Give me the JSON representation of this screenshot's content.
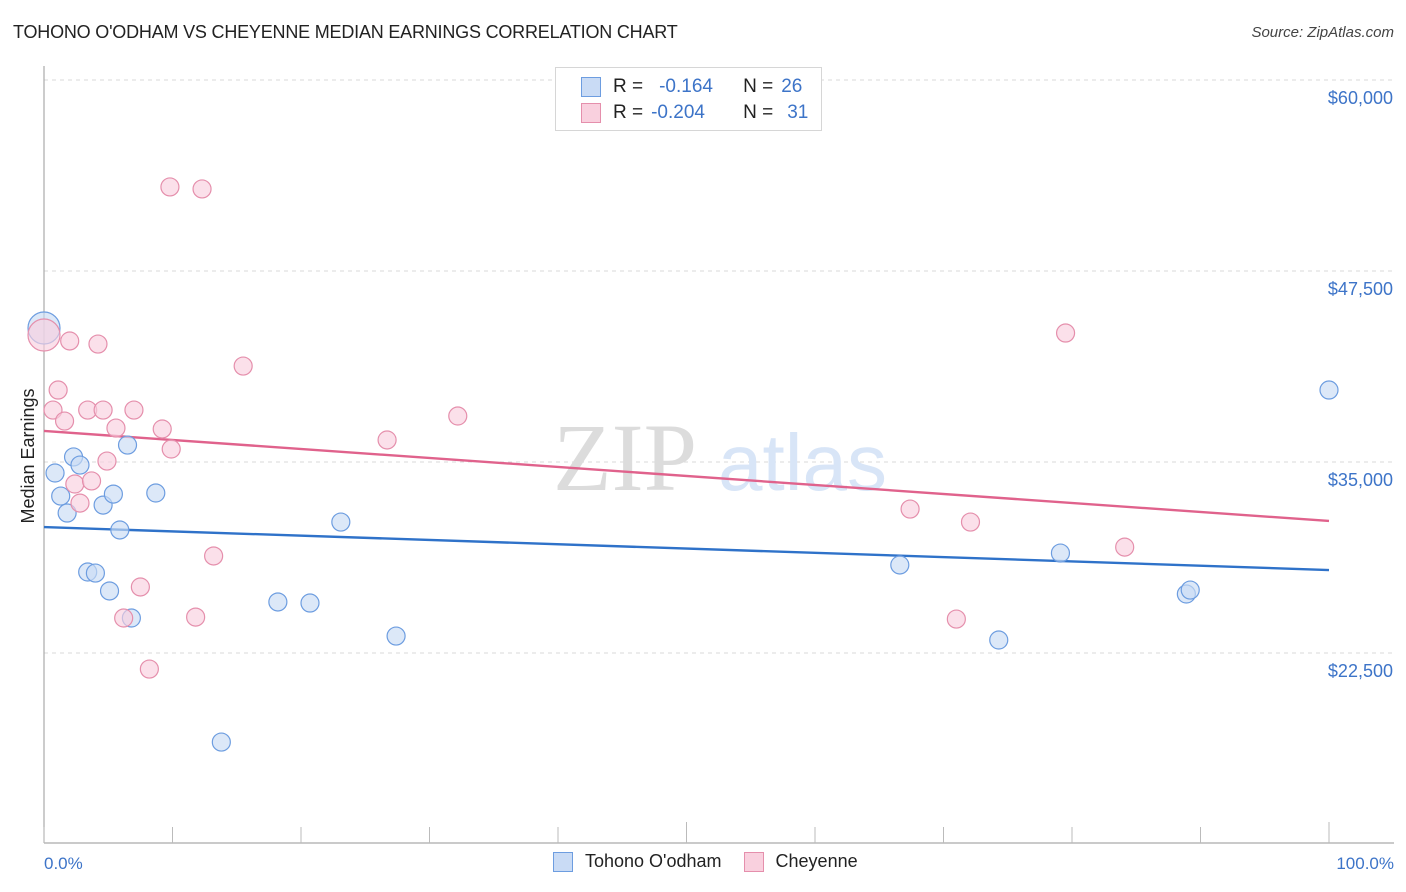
{
  "chart_data": {
    "type": "scatter",
    "title": "TOHONO O'ODHAM VS CHEYENNE MEDIAN EARNINGS CORRELATION CHART",
    "source": "Source: ZipAtlas.com",
    "watermark": {
      "zip": "ZIP",
      "atlas": "atlas"
    },
    "xlabel": "",
    "ylabel": "Median Earnings",
    "xlim": [
      0,
      100
    ],
    "ylim": [
      10000,
      62000
    ],
    "x_tick_labels": {
      "left": "0.0%",
      "right": "100.0%"
    },
    "y_ticks": [
      {
        "value": 60000,
        "label": "$60,000"
      },
      {
        "value": 47500,
        "label": "$47,500"
      },
      {
        "value": 35000,
        "label": "$35,000"
      },
      {
        "value": 22500,
        "label": "$22,500"
      }
    ],
    "grid": true,
    "legend_placement": "top-center",
    "series": [
      {
        "name": "Tohono O'odham",
        "color": "#6d9de0",
        "fill": "#c9dbf5",
        "line_color": "#2f72c9",
        "R": "-0.164",
        "N": "26",
        "trend": {
          "x": [
            0,
            100
          ],
          "y": [
            30740,
            27930
          ]
        },
        "points": [
          {
            "x": 0.0,
            "y": 43770,
            "big": true
          },
          {
            "x": 0.86,
            "y": 34280
          },
          {
            "x": 1.3,
            "y": 32770
          },
          {
            "x": 1.8,
            "y": 31660
          },
          {
            "x": 2.3,
            "y": 35330
          },
          {
            "x": 2.8,
            "y": 34800
          },
          {
            "x": 3.4,
            "y": 27800
          },
          {
            "x": 4.0,
            "y": 27730
          },
          {
            "x": 4.6,
            "y": 32180
          },
          {
            "x": 5.1,
            "y": 26560
          },
          {
            "x": 5.4,
            "y": 32900
          },
          {
            "x": 5.9,
            "y": 30550
          },
          {
            "x": 6.5,
            "y": 36110
          },
          {
            "x": 6.8,
            "y": 24790
          },
          {
            "x": 8.7,
            "y": 32970
          },
          {
            "x": 13.8,
            "y": 16670
          },
          {
            "x": 18.2,
            "y": 25840
          },
          {
            "x": 20.7,
            "y": 25770
          },
          {
            "x": 23.1,
            "y": 31070
          },
          {
            "x": 27.4,
            "y": 23610
          },
          {
            "x": 66.6,
            "y": 28260
          },
          {
            "x": 74.3,
            "y": 23350
          },
          {
            "x": 79.1,
            "y": 29040
          },
          {
            "x": 88.9,
            "y": 26360
          },
          {
            "x": 89.2,
            "y": 26620
          },
          {
            "x": 100.0,
            "y": 39710
          }
        ]
      },
      {
        "name": "Cheyenne",
        "color": "#e58fac",
        "fill": "#f9d0de",
        "line_color": "#e0628c",
        "R": "-0.204",
        "N": "31",
        "trend": {
          "x": [
            0,
            100
          ],
          "y": [
            37030,
            31140
          ]
        },
        "points": [
          {
            "x": 0.0,
            "y": 43310,
            "big": true
          },
          {
            "x": 0.7,
            "y": 38400
          },
          {
            "x": 1.1,
            "y": 39710
          },
          {
            "x": 1.6,
            "y": 37680
          },
          {
            "x": 2.0,
            "y": 42920
          },
          {
            "x": 2.4,
            "y": 33560
          },
          {
            "x": 2.8,
            "y": 32310
          },
          {
            "x": 3.4,
            "y": 38400
          },
          {
            "x": 3.7,
            "y": 33760
          },
          {
            "x": 4.2,
            "y": 42720
          },
          {
            "x": 4.6,
            "y": 38400
          },
          {
            "x": 4.9,
            "y": 35060
          },
          {
            "x": 5.6,
            "y": 37220
          },
          {
            "x": 6.2,
            "y": 24790
          },
          {
            "x": 7.0,
            "y": 38400
          },
          {
            "x": 7.5,
            "y": 26820
          },
          {
            "x": 8.2,
            "y": 21450
          },
          {
            "x": 9.2,
            "y": 37160
          },
          {
            "x": 9.8,
            "y": 53000
          },
          {
            "x": 9.9,
            "y": 35850
          },
          {
            "x": 11.8,
            "y": 24850
          },
          {
            "x": 12.3,
            "y": 52870
          },
          {
            "x": 13.2,
            "y": 28850
          },
          {
            "x": 15.5,
            "y": 41280
          },
          {
            "x": 26.7,
            "y": 36440
          },
          {
            "x": 32.2,
            "y": 38010
          },
          {
            "x": 67.4,
            "y": 31920
          },
          {
            "x": 71.0,
            "y": 24720
          },
          {
            "x": 72.1,
            "y": 31070
          },
          {
            "x": 79.5,
            "y": 43440
          },
          {
            "x": 84.1,
            "y": 29430
          }
        ]
      }
    ]
  },
  "legend": {
    "r_label": "R =",
    "n_label": "N =",
    "rows": [
      {
        "r": "-0.164",
        "n": "26"
      },
      {
        "r": "-0.204",
        "n": "31"
      }
    ]
  }
}
